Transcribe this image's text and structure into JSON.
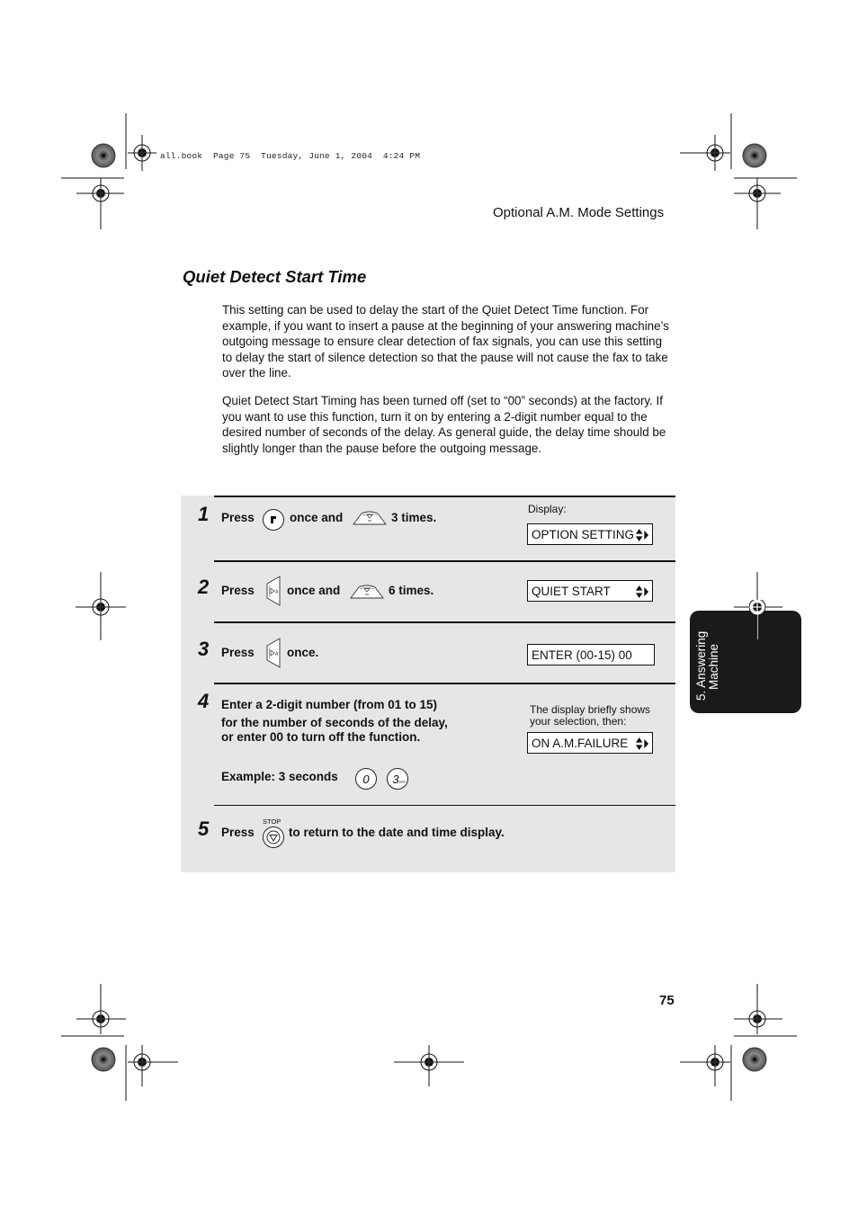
{
  "printer_line": "all.book  Page 75  Tuesday, June 1, 2004  4:24 PM",
  "header": {
    "title": "Optional A.M. Mode Settings"
  },
  "section": {
    "title": "Quiet Detect Start Time",
    "paragraphs": [
      "This setting can be used to delay the start of the Quiet Detect Time function. For example, if you want to insert a pause at the beginning of your answering machine’s outgoing message to ensure clear detection of fax signals, you can use this setting to delay the start of silence detection so that the pause will not cause the fax to take over the line.",
      "Quiet Detect Start Timing has been turned off (set to “00” seconds) at the factory. If you want to use this function, turn it on by entering a 2-digit number equal to the desired number of seconds of the delay. As general guide, the delay time should be slightly longer than the pause before the outgoing message."
    ]
  },
  "steps": [
    {
      "number": "1",
      "press": "Press",
      "mid": "once and",
      "end": "3 times.",
      "display_label": "Display:",
      "display": "OPTION SETTING",
      "icons": [
        "function-key-icon",
        "down-arrow-key-icon"
      ]
    },
    {
      "number": "2",
      "press": "Press",
      "mid": "once and",
      "end": "6 times.",
      "display": "QUIET START",
      "icons": [
        "right-arrow-key-icon",
        "down-arrow-key-icon"
      ]
    },
    {
      "number": "3",
      "press": "Press",
      "end": "once.",
      "display": "ENTER (00-15) 00",
      "icons": [
        "right-arrow-key-icon"
      ]
    },
    {
      "number": "4",
      "line1": "Enter a 2-digit number (from 01 to 15)",
      "line2": "for the number of seconds of the delay,",
      "line3": "or enter 00 to turn off the function.",
      "example": "Example: 3 seconds",
      "key0": "0",
      "key3": "3",
      "key3_sub": "DEF",
      "display_note": "The display briefly shows your selection, then:",
      "display": "ON A.M.FAILURE"
    },
    {
      "number": "5",
      "press": "Press",
      "stop_label": "STOP",
      "end": "to return to the date and time display."
    }
  ],
  "side_tab": {
    "line1": "5. Answering",
    "line2": "Machine"
  },
  "page_number": "75"
}
